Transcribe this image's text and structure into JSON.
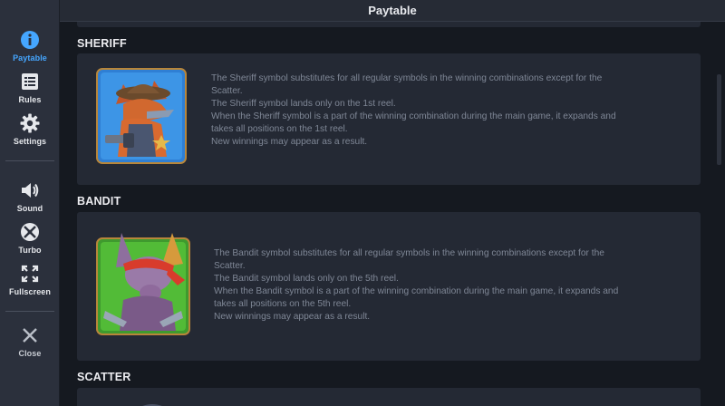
{
  "header": {
    "title": "Paytable"
  },
  "sidebar": {
    "items": [
      {
        "label": "Paytable",
        "icon": "info-icon",
        "active": true
      },
      {
        "label": "Rules",
        "icon": "list-icon"
      },
      {
        "label": "Settings",
        "icon": "gear-icon"
      },
      {
        "label": "Sound",
        "icon": "speaker-icon"
      },
      {
        "label": "Turbo",
        "icon": "turbo-icon"
      },
      {
        "label": "Fullscreen",
        "icon": "fullscreen-icon"
      },
      {
        "label": "Close",
        "icon": "close-icon"
      }
    ]
  },
  "sections": [
    {
      "title": "SHERIFF",
      "lines": [
        "The Sheriff symbol substitutes for all regular symbols in the winning combinations except for the",
        "Scatter.",
        "The Sheriff symbol lands only on the 1st reel.",
        "When the Sheriff symbol is a part of the winning combination during the main game, it expands and",
        "takes all positions on the 1st reel.",
        "New winnings may appear as a result."
      ]
    },
    {
      "title": "BANDIT",
      "lines": [
        "The Bandit symbol substitutes for all regular symbols in the winning combinations except for the",
        "Scatter.",
        "The Bandit symbol lands only on the 5th reel.",
        "When the Bandit symbol is a part of the winning combination during the main game, it expands and",
        "takes all positions on the 5th reel.",
        "New winnings may appear as a result."
      ]
    },
    {
      "title": "SCATTER"
    }
  ],
  "colors": {
    "accent": "#45a6ff",
    "panel": "#242934",
    "sidebar": "#2b303c",
    "text_muted": "#7f8796"
  }
}
